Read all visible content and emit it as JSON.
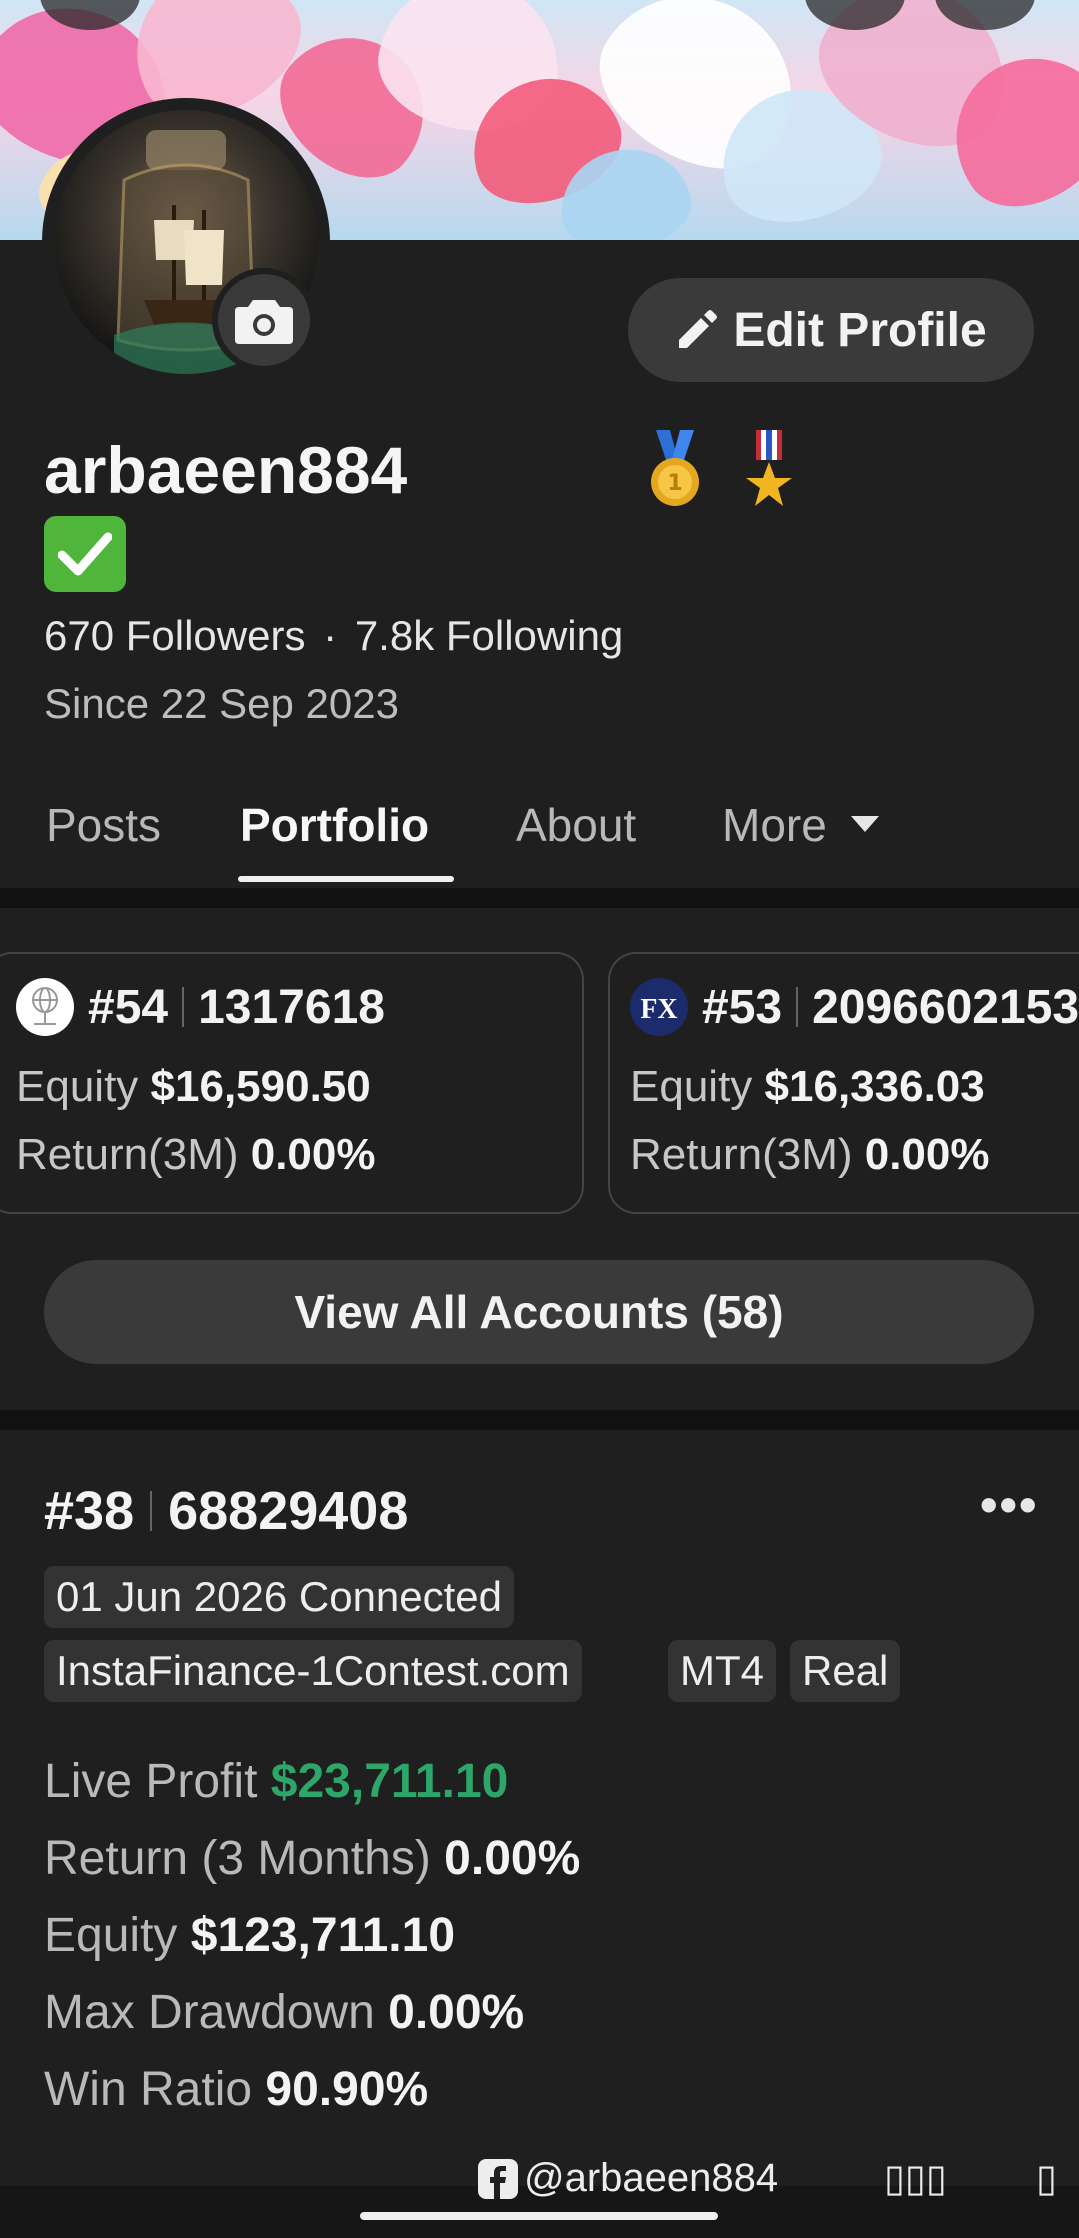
{
  "profile": {
    "edit_label": "Edit Profile",
    "username": "arbaeen884",
    "medals": [
      "🥇",
      "🎖️"
    ],
    "verified_icon": "✅",
    "followers": "670 Followers",
    "following": "7.8k Following",
    "stats_sep": "·",
    "since": "Since 22 Sep 2023"
  },
  "tabs": [
    {
      "label": "Posts"
    },
    {
      "label": "Portfolio",
      "active": true
    },
    {
      "label": "About"
    },
    {
      "label": "More"
    }
  ],
  "accounts": [
    {
      "rank": "#54",
      "id": "1317618",
      "equity_label": "Equity",
      "equity": "$16,590.50",
      "return_label": "Return(3M)",
      "return": "0.00%"
    },
    {
      "rank": "#53",
      "id": "2096602153",
      "logo_text": "FX",
      "equity_label": "Equity",
      "equity": "$16,336.03",
      "return_label": "Return(3M)",
      "return": "0.00%"
    }
  ],
  "view_all_label": "View All Accounts (58)",
  "featured": {
    "rank": "#38",
    "id": "68829408",
    "more_icon": "•••",
    "connected": "01 Jun 2026 Connected",
    "server": "InstaFinance-1Contest.com",
    "platform": "MT4",
    "type": "Real",
    "metrics": [
      {
        "label": "Live Profit",
        "value": "$23,711.10"
      },
      {
        "label": "Return (3 Months)",
        "value": "0.00%"
      },
      {
        "label": "Equity",
        "value": "$123,711.10"
      },
      {
        "label": "Max Drawdown",
        "value": "0.00%"
      },
      {
        "label": "Win Ratio",
        "value": "90.90%"
      }
    ]
  },
  "watermark": {
    "handle": "@arbaeen884",
    "boxes": "▯▯▯",
    "box_single": "▯"
  },
  "colors": {
    "accent_green": "#2ea66a",
    "background": "#1f1f1f",
    "button": "#3a3a3a"
  }
}
